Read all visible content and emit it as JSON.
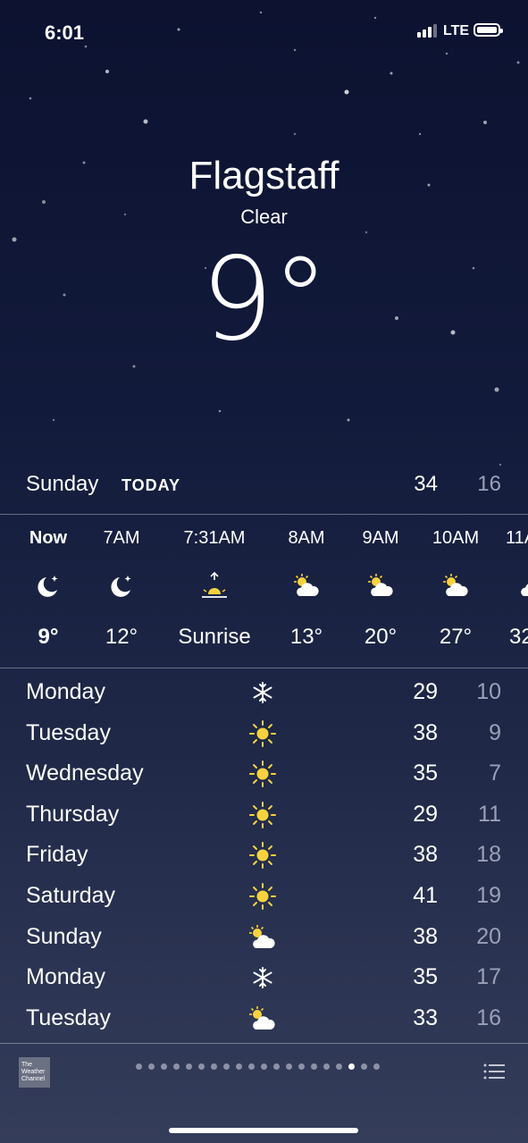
{
  "status": {
    "time": "6:01",
    "network": "LTE"
  },
  "location": {
    "city": "Flagstaff",
    "condition": "Clear",
    "temperature": "9°"
  },
  "today": {
    "day": "Sunday",
    "label": "TODAY",
    "high": "34",
    "low": "16"
  },
  "hourly": [
    {
      "time": "Now",
      "icon": "moon-stars-icon",
      "value": "9°"
    },
    {
      "time": "7AM",
      "icon": "moon-stars-icon",
      "value": "12°"
    },
    {
      "time": "7:31AM",
      "icon": "sunrise-icon",
      "value": "Sunrise"
    },
    {
      "time": "8AM",
      "icon": "sun-cloud-icon",
      "value": "13°"
    },
    {
      "time": "9AM",
      "icon": "sun-cloud-icon",
      "value": "20°"
    },
    {
      "time": "10AM",
      "icon": "sun-cloud-icon",
      "value": "27°"
    },
    {
      "time": "11A",
      "icon": "cloud-icon",
      "value": "32"
    }
  ],
  "daily": [
    {
      "day": "Monday",
      "icon": "snowflake-icon",
      "high": "29",
      "low": "10"
    },
    {
      "day": "Tuesday",
      "icon": "sun-icon",
      "high": "38",
      "low": "9"
    },
    {
      "day": "Wednesday",
      "icon": "sun-icon",
      "high": "35",
      "low": "7"
    },
    {
      "day": "Thursday",
      "icon": "sun-icon",
      "high": "29",
      "low": "11"
    },
    {
      "day": "Friday",
      "icon": "sun-icon",
      "high": "38",
      "low": "18"
    },
    {
      "day": "Saturday",
      "icon": "sun-icon",
      "high": "41",
      "low": "19"
    },
    {
      "day": "Sunday",
      "icon": "sun-cloud-icon",
      "high": "38",
      "low": "20"
    },
    {
      "day": "Monday",
      "icon": "snowflake-icon",
      "high": "35",
      "low": "17"
    },
    {
      "day": "Tuesday",
      "icon": "sun-cloud-icon",
      "high": "33",
      "low": "16"
    }
  ],
  "footer": {
    "brand": "The Weather Channel",
    "pages": 20,
    "active_page": 18
  },
  "colors": {
    "sun": "#f7d23e",
    "low_temp": "#9aa0b8"
  }
}
